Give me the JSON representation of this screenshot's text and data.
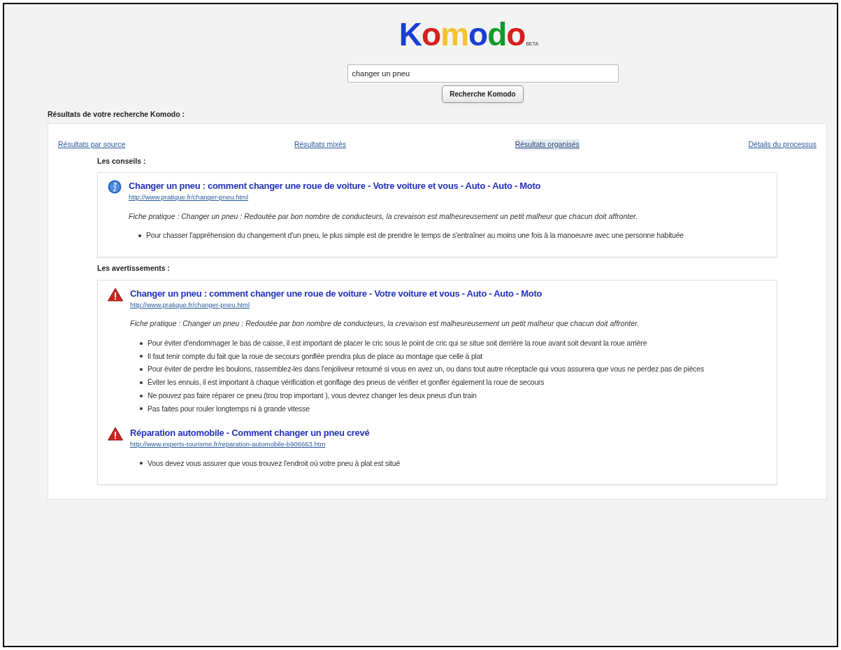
{
  "logo": {
    "text": "Komodo",
    "badge": "BETA"
  },
  "search": {
    "value": "changer un pneu",
    "button": "Recherche Komodo"
  },
  "results_heading": "Résultats de votre recherche Komodo :",
  "tabs": [
    {
      "label": "Résultats par source",
      "selected": false
    },
    {
      "label": "Résultats mixés",
      "selected": false
    },
    {
      "label": "Résultats organisés",
      "selected": true
    },
    {
      "label": "Détails du processus",
      "selected": false
    }
  ],
  "sections": [
    {
      "heading": "Les conseils :",
      "results": [
        {
          "kind": "info",
          "title": "Changer un pneu : comment changer une roue de voiture - Votre voiture et vous - Auto - Auto - Moto",
          "url": "http://www.pratique.fr/changer-pneu.html",
          "snippet": "Fiche pratique : Changer un pneu : Redoutée par bon nombre de conducteurs, la crevaison est malheureusement un petit malheur que chacun doit affronter.",
          "bullets": [
            "Pour chasser l'appréhension du changement d'un pneu, le plus simple est de prendre le temps de s'entraîner au moins une fois à la manoeuvre avec une personne habituée"
          ]
        }
      ]
    },
    {
      "heading": "Les avertissements :",
      "results": [
        {
          "kind": "warning",
          "title": "Changer un pneu : comment changer une roue de voiture - Votre voiture et vous - Auto - Auto - Moto",
          "url": "http://www.pratique.fr/changer-pneu.html",
          "snippet": "Fiche pratique : Changer un pneu : Redoutée par bon nombre de conducteurs, la crevaison est malheureusement un petit malheur que chacun doit affronter.",
          "bullets": [
            "Pour éviter d'endommager le bas de caisse, il est important de placer le cric sous le point de cric qui se situe soit derrière la roue avant soit devant la roue arrière",
            "Il faut tenir compte du fait que la roue de secours gonflée prendra plus de place au montage que celle à plat",
            "Pour éviter de perdre les boulons, rassemblez-les dans l'enjoliveur retourné si vous en avez un, ou dans tout autre réceptacle qui vous assurera que vous ne perdez pas de pièces",
            "Éviter les ennuis, il est important à chaque vérification et gonflage des pneus de vérifier et gonfler également la roue de secours",
            "Ne pouvez pas faire réparer ce pneu (trou trop important ), vous devrez changer les deux pneus d'un train",
            "Pas faites pour rouler longtemps ni à grande vitesse"
          ]
        },
        {
          "kind": "warning",
          "title": "Réparation automobile - Comment changer un pneu crevé",
          "url": "http://www.experts-tourisme.fr/reparation-automobile-b906663.htm",
          "bullets": [
            "Vous devez vous assurer que vous trouvez l'endroit où votre pneu à plat est situé"
          ]
        }
      ]
    }
  ]
}
